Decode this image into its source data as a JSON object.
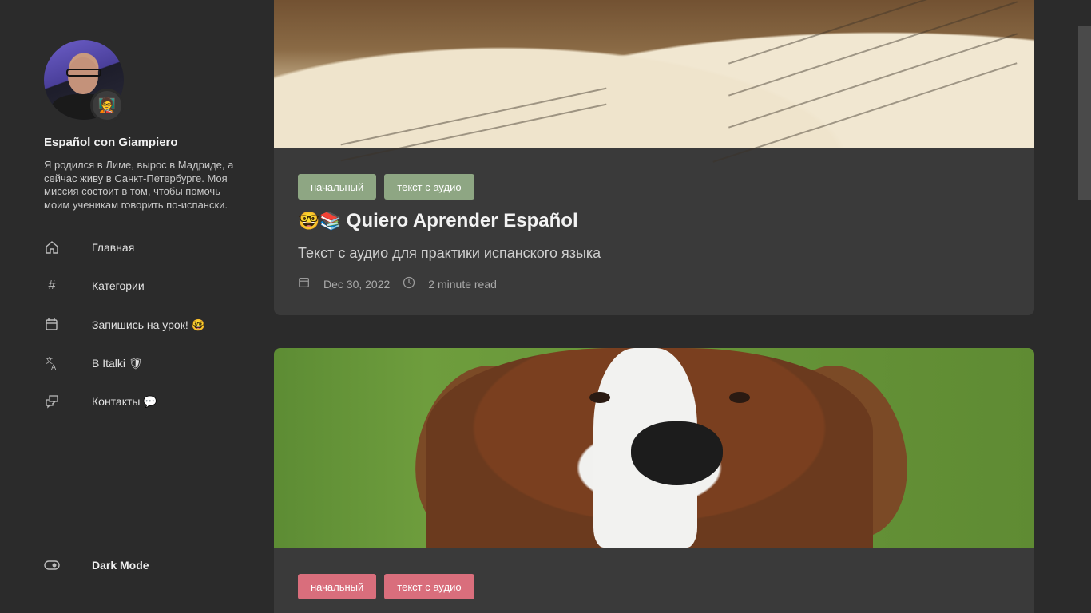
{
  "profile": {
    "name": "Español con Giampiero",
    "description": "Я родился в Лиме, вырос в Мадриде, а сейчас живу в Санкт-Петербурге. Моя миссия состоит в том, чтобы помочь моим ученикам говорить по-испански.",
    "badge_icon": "teacher-emoji"
  },
  "nav": {
    "items": [
      {
        "label": "Главная",
        "icon": "home-icon"
      },
      {
        "label": "Категории",
        "icon": "hash-icon"
      },
      {
        "label": "Запишись на урок! 🤓",
        "icon": "calendar-icon"
      },
      {
        "label": "В Italki 🛡",
        "icon": "translate-icon"
      },
      {
        "label": "Контакты 💬",
        "icon": "chat-icon"
      }
    ],
    "dark_mode": {
      "label": "Dark Mode",
      "icon": "toggle-icon"
    }
  },
  "posts": [
    {
      "tags": [
        "начальный",
        "текст с аудио"
      ],
      "title_emoji": "🤓📚",
      "title": "Quiero Aprender Español",
      "subtitle": "Текст с аудио для практики испанского языка",
      "date": "Dec 30, 2022",
      "read_time": "2 minute read",
      "tag_color": "#8ea683"
    },
    {
      "tags": [
        "начальный",
        "текст с аудио"
      ],
      "tag_color": "#d96e7c"
    }
  ]
}
